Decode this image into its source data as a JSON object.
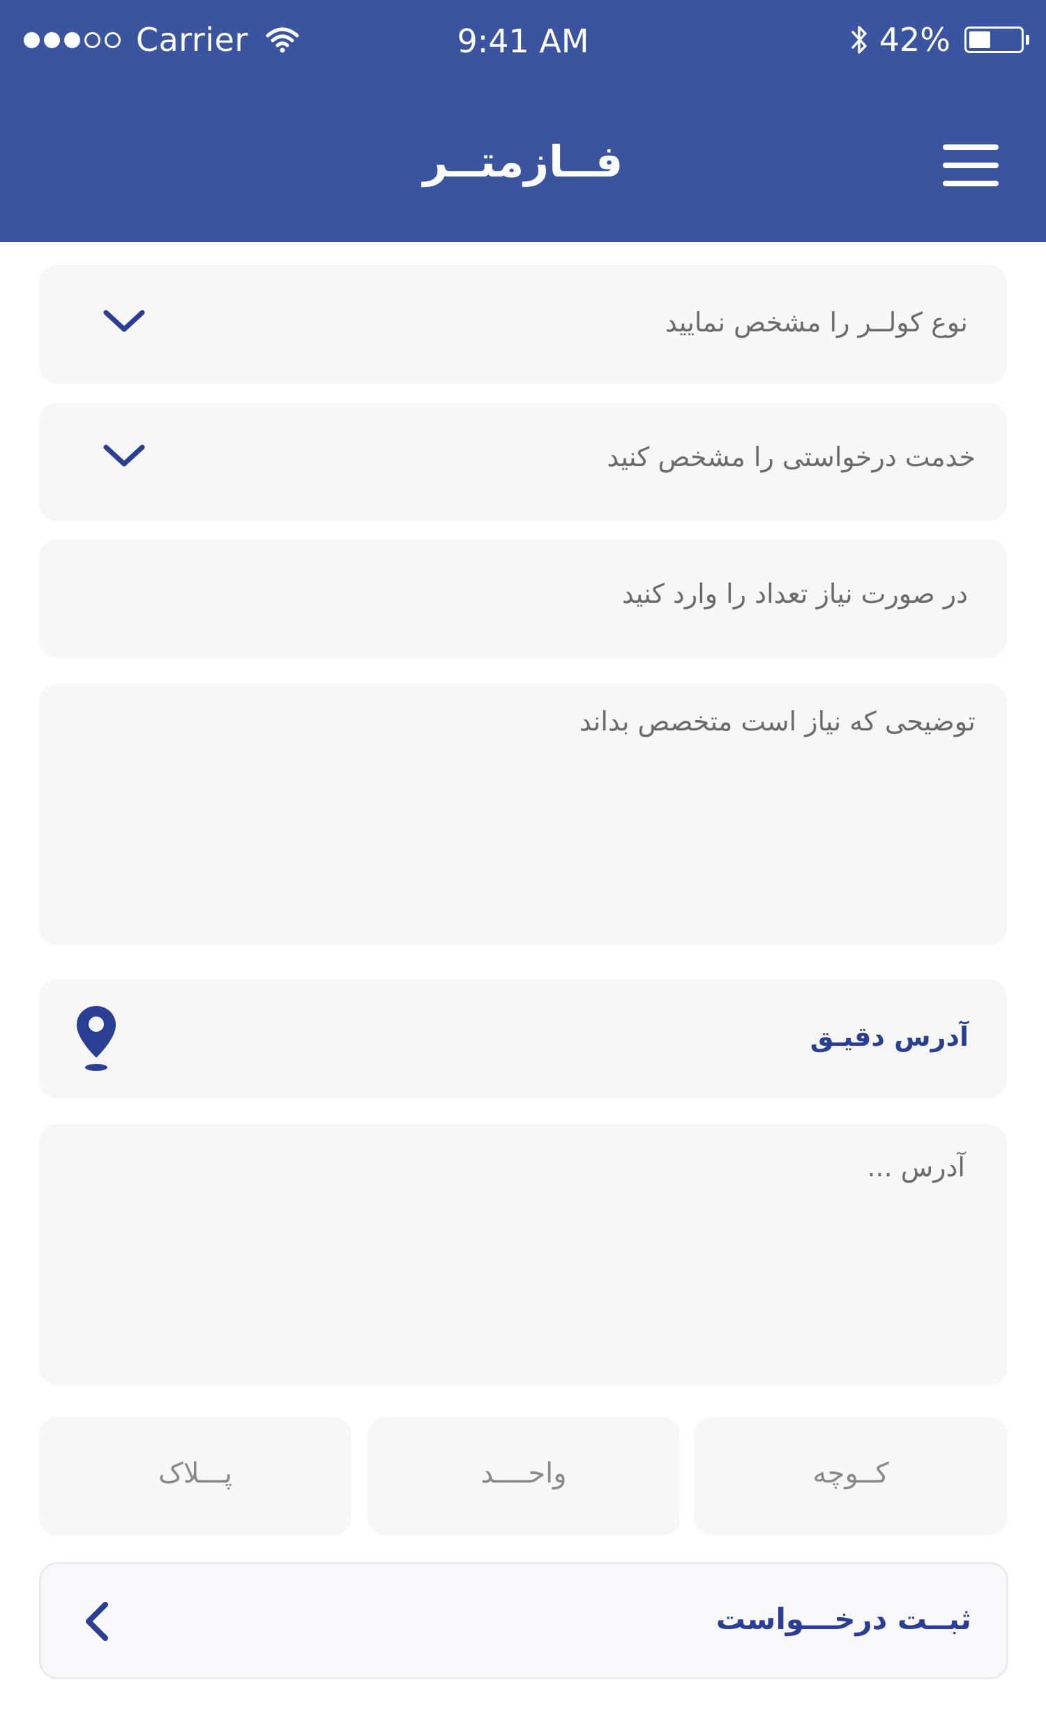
{
  "status_bar": {
    "carrier": "Carrier",
    "time": "9:41 AM",
    "battery_percent": "42%",
    "battery_level": 0.42,
    "signal_bars_filled": 3,
    "signal_bars_total": 5,
    "icons": [
      "wifi-icon",
      "bluetooth-icon",
      "battery-icon"
    ]
  },
  "header": {
    "title": "فــازمتــر",
    "menu_icon": "hamburger-menu-icon",
    "background_color": "#3A54A0"
  },
  "form": {
    "cooler_type": {
      "placeholder": "نوع کولــر را مشخص نمایید",
      "icon": "chevron-down-icon"
    },
    "service": {
      "placeholder": "خدمت درخواستی را مشخص کنید",
      "icon": "chevron-down-icon"
    },
    "quantity": {
      "placeholder": "در صورت نیاز تعداد را وارد کنید"
    },
    "description": {
      "placeholder": "توضیحی که نیاز است متخصص بداند"
    },
    "exact_address": {
      "label": "آدرس دقیـق",
      "icon": "location-pin-icon"
    },
    "address": {
      "placeholder": "آدرس ..."
    },
    "street": {
      "placeholder": "کــوچه"
    },
    "unit": {
      "placeholder": "واحــــد"
    },
    "plate": {
      "placeholder": "پـــلاک"
    }
  },
  "submit": {
    "label": "ثبــت درخـــواست",
    "icon": "chevron-left-icon"
  },
  "colors": {
    "accent": "#2A3E93",
    "header": "#3A54A0",
    "field_background": "#F7F7F7"
  }
}
